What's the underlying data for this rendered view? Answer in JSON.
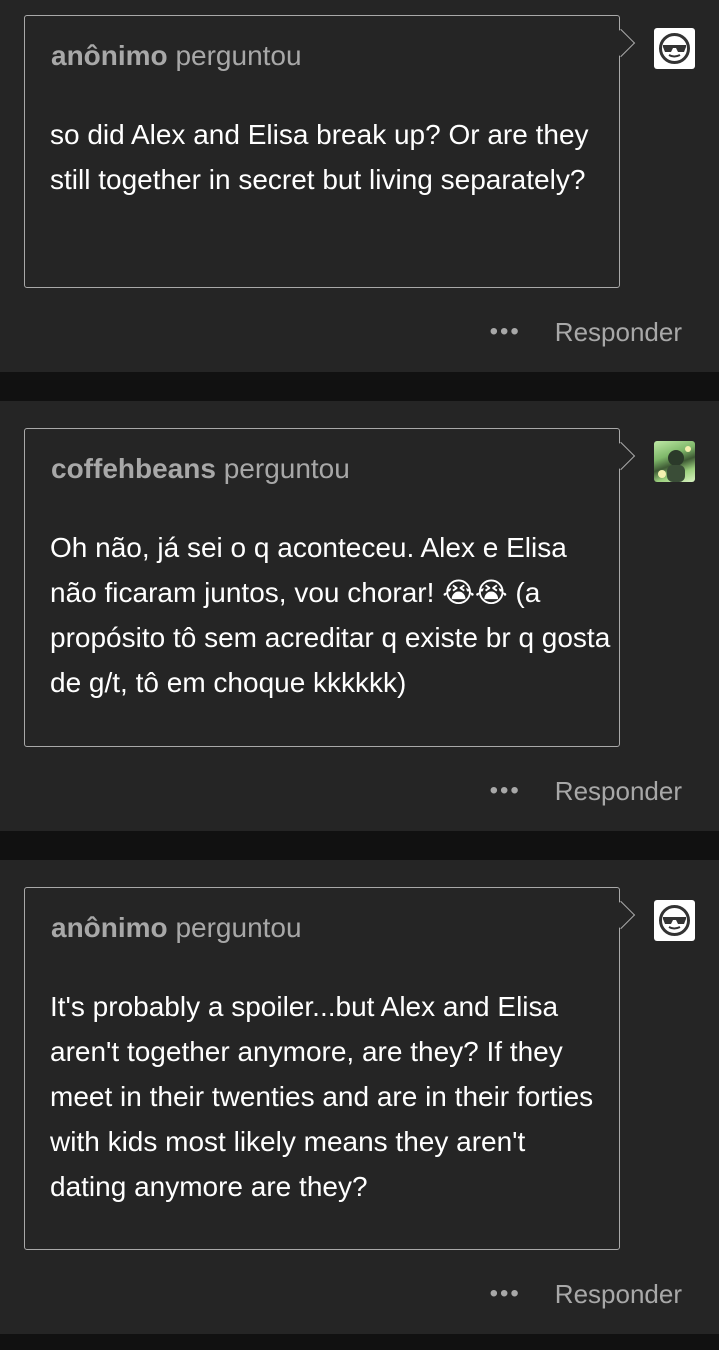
{
  "posts": [
    {
      "asker_name": "anônimo",
      "asked_verb": "perguntou",
      "question": "so did Alex and Elisa break up? Or are they still together in secret but living separately?",
      "avatar_icon": "anonymous-sunglasses-avatar-icon",
      "more_label": "•••",
      "reply_label": "Responder"
    },
    {
      "asker_name": "coffehbeans",
      "asked_verb": "perguntou",
      "question": "Oh não, já sei o q aconteceu. Alex e Elisa não ficaram juntos, vou chorar! 😭😭 (a propósito tô sem acreditar q existe br q gosta de g/t, tô em choque kkkkkk)",
      "avatar_icon": "user-photo-avatar",
      "more_label": "•••",
      "reply_label": "Responder"
    },
    {
      "asker_name": "anônimo",
      "asked_verb": "perguntou",
      "question": "It's probably a spoiler...but Alex and Elisa aren't together anymore, are they? If they meet in their twenties and are in their forties with kids most likely means they aren't dating anymore are they?",
      "avatar_icon": "anonymous-sunglasses-avatar-icon",
      "more_label": "•••",
      "reply_label": "Responder"
    }
  ],
  "colors": {
    "page_background": "#111111",
    "card_background": "#252525",
    "bubble_border": "#a9a9a9",
    "muted_text": "#a8a8a8",
    "question_text": "#ffffff"
  }
}
